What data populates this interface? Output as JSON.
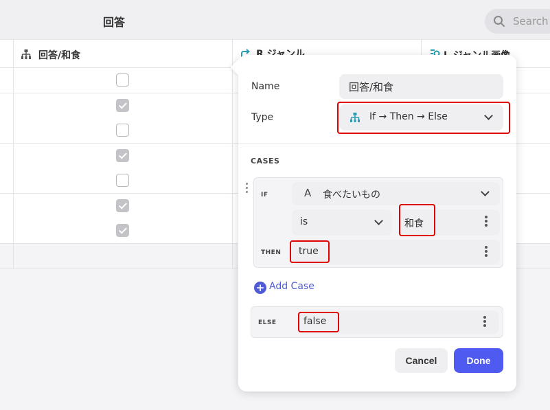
{
  "header": {
    "title": "回答",
    "search_placeholder": "Search"
  },
  "columns": [
    {
      "label": "回答/和食"
    },
    {
      "label": "R ジャンル"
    },
    {
      "label": "L ジャンル画像"
    }
  ],
  "rows": [
    {
      "checked": false
    },
    {
      "checked": true
    },
    {
      "checked": false
    },
    {
      "checked": true
    },
    {
      "checked": false
    },
    {
      "checked": true
    },
    {
      "checked": true
    }
  ],
  "editor": {
    "name_label": "Name",
    "name_value": "回答/和食",
    "type_label": "Type",
    "type_value": "If → Then → Else",
    "cases_header": "CASES",
    "case": {
      "if_label": "IF",
      "column_icon_text": "A",
      "column_value": "食べたいもの",
      "operator_value": "is",
      "compare_value": "和食",
      "then_label": "THEN",
      "then_value": "true"
    },
    "add_case_label": "Add Case",
    "else_label": "ELSE",
    "else_value": "false",
    "cancel_label": "Cancel",
    "done_label": "Done"
  },
  "colors": {
    "accent": "#4f5bf0",
    "highlight": "#e00000",
    "icon_teal": "#2a9fb3"
  }
}
